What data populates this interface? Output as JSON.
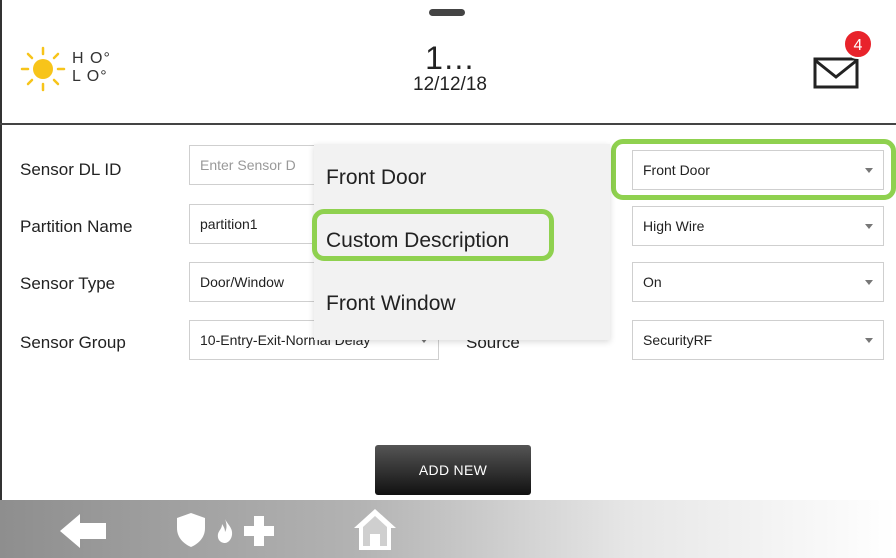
{
  "header": {
    "weather": {
      "icon": "sun-icon",
      "hi": "H O°",
      "lo": "L O°"
    },
    "clock": {
      "time": "1…",
      "date": "12/12/18"
    },
    "messages": {
      "icon": "envelope-icon",
      "count": "4"
    }
  },
  "form": {
    "rows": [
      {
        "label": "Sensor DL ID",
        "value": "Enter Sensor D",
        "is_placeholder": true
      },
      {
        "label": "Partition Name",
        "value": "partition1"
      },
      {
        "label": "Sensor Type",
        "value": "Door/Window"
      },
      {
        "label": "Sensor Group",
        "value": "10-Entry-Exit-Normal Delay"
      }
    ],
    "right_column": {
      "source_label": "Source",
      "fields": [
        "Front Door",
        "High Wire",
        "On",
        "SecurityRF"
      ]
    }
  },
  "dropdown": {
    "options": [
      "Front Door",
      "Custom Description",
      "Front Window"
    ],
    "highlighted": "Custom Description"
  },
  "actions": {
    "add_new": "ADD NEW"
  },
  "navbar": {
    "icons": [
      "back-arrow-icon",
      "shield-icon",
      "fire-icon",
      "medical-plus-icon",
      "home-icon"
    ]
  },
  "colors": {
    "highlight": "#8fd14f",
    "badge": "#e8232b",
    "sun": "#f7c41a"
  }
}
